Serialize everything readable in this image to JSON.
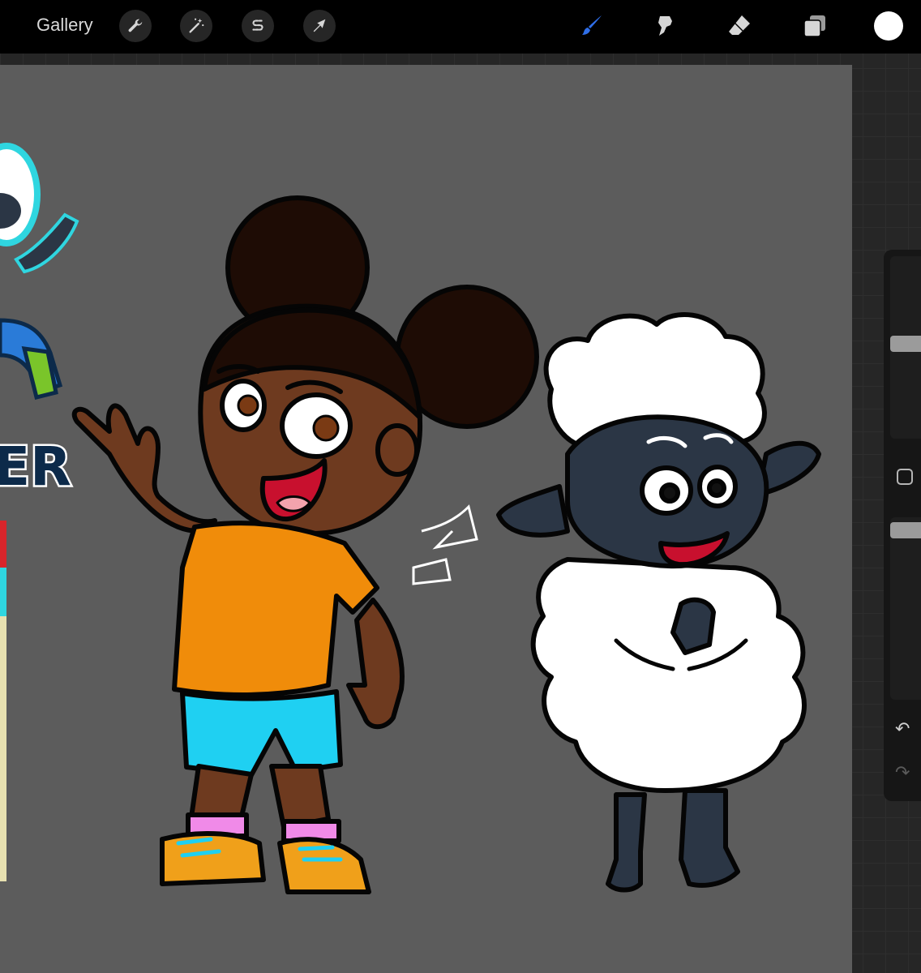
{
  "toolbar": {
    "gallery_label": "Gallery",
    "left_tools": [
      "wrench-icon",
      "magic-wand-icon",
      "selection-s-icon",
      "transform-arrow-icon"
    ],
    "right_tools": [
      "brush-icon",
      "smudge-icon",
      "eraser-icon",
      "layers-icon"
    ],
    "active_tool": "brush",
    "active_color": "#ffffff",
    "brush_accent": "#2f6ee8"
  },
  "sidebar": {
    "brush_size_level": 0.18,
    "opacity_level": 0.06,
    "modify_button": "square-icon",
    "undo": "↶",
    "redo": "↷"
  },
  "canvas": {
    "background": "#5c5c5c",
    "colors": {
      "skin": "#6e3a1f",
      "hair": "#1e0c05",
      "shirt": "#f08c0a",
      "shorts": "#1fd0f2",
      "socks": "#f08ae8",
      "shoes": "#f0a01a",
      "sheep_face": "#2b3645",
      "wool": "#ffffff",
      "mouth": "#c8102e"
    }
  }
}
